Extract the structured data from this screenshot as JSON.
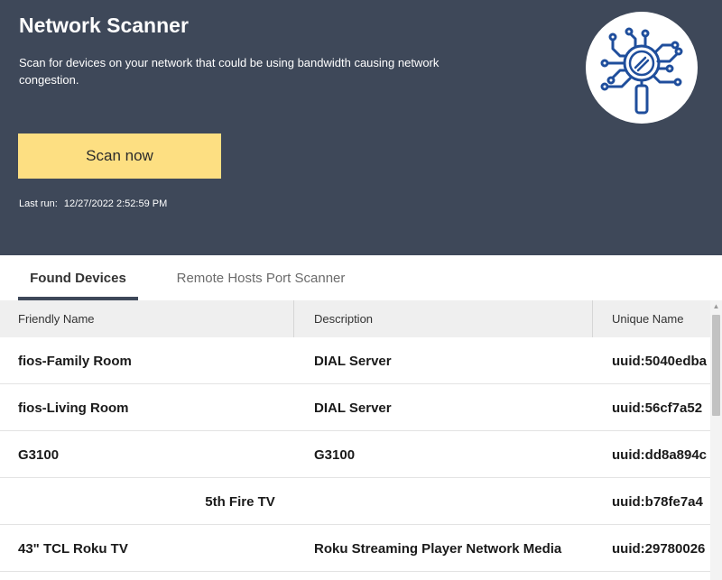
{
  "header": {
    "title": "Network Scanner",
    "description": "Scan for devices on your network that could be using bandwidth causing network congestion.",
    "scan_button": "Scan now",
    "last_run_label": "Last run:",
    "last_run_value": "12/27/2022 2:52:59 PM",
    "logo_icon": "network-scan-magnifier-icon"
  },
  "tabs": [
    {
      "label": "Found Devices",
      "active": true
    },
    {
      "label": "Remote Hosts Port Scanner",
      "active": false
    }
  ],
  "table": {
    "columns": [
      "Friendly Name",
      "Description",
      "Unique Name"
    ],
    "rows": [
      {
        "friendly_name": "fios-Family Room",
        "description": "DIAL Server",
        "unique_name": "uuid:5040edba"
      },
      {
        "friendly_name": "fios-Living Room",
        "description": "DIAL Server",
        "unique_name": "uuid:56cf7a52"
      },
      {
        "friendly_name": "G3100",
        "description": "G3100",
        "unique_name": "uuid:dd8a894c"
      },
      {
        "friendly_name": "5th Fire TV",
        "description": "",
        "unique_name": "uuid:b78fe7a4"
      },
      {
        "friendly_name": "43\" TCL Roku TV",
        "description": "Roku Streaming Player Network Media",
        "unique_name": "uuid:29780026"
      }
    ]
  },
  "colors": {
    "header_bg": "#3e4859",
    "scan_button_bg": "#fddf82",
    "logo_stroke": "#1f4e9c",
    "tab_underline": "#3e4859"
  }
}
